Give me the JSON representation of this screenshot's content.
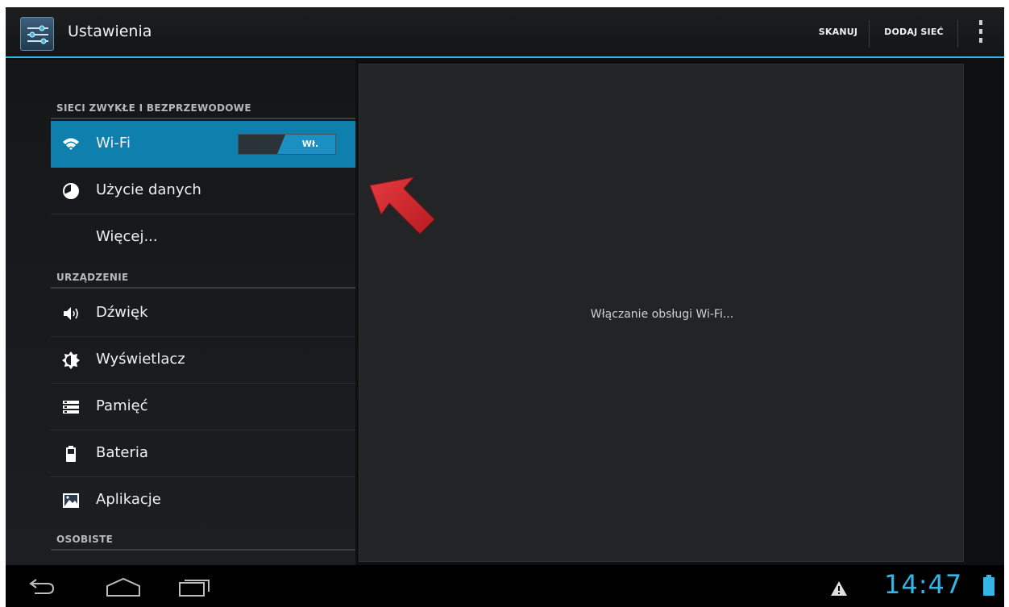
{
  "action_bar": {
    "title": "Ustawienia",
    "scan_label": "SKANUJ",
    "add_network_label": "DODAJ SIEĆ",
    "app_icon": "settings-sliders-icon",
    "overflow_icon": "overflow-menu-icon"
  },
  "sections": {
    "wireless_header": "SIECI ZWYKŁE I BEZPRZEWODOWE",
    "device_header": "URZĄDZENIE",
    "personal_header": "OSOBISTE"
  },
  "items": {
    "wifi": {
      "label": "Wi-Fi",
      "icon": "wifi-icon",
      "toggle_label": "Wł.",
      "toggle_state": "on"
    },
    "data_usage": {
      "label": "Użycie danych",
      "icon": "data-usage-icon"
    },
    "more": {
      "label": "Więcej..."
    },
    "sound": {
      "label": "Dźwięk",
      "icon": "speaker-icon"
    },
    "display": {
      "label": "Wyświetlacz",
      "icon": "brightness-icon"
    },
    "storage": {
      "label": "Pamięć",
      "icon": "storage-icon"
    },
    "battery": {
      "label": "Bateria",
      "icon": "battery-icon"
    },
    "apps": {
      "label": "Aplikacje",
      "icon": "apps-icon"
    }
  },
  "detail": {
    "status": "Włączanie obsługi Wi-Fi..."
  },
  "nav_bar": {
    "back_icon": "back-icon",
    "home_icon": "home-icon",
    "recents_icon": "recents-icon",
    "warning_icon": "warning-icon",
    "clock": "14:47",
    "battery_icon": "battery-status-icon"
  },
  "colors": {
    "accent": "#33b5e5",
    "selected_item": "#0f7fae",
    "annotation_arrow": "#d9262c"
  }
}
